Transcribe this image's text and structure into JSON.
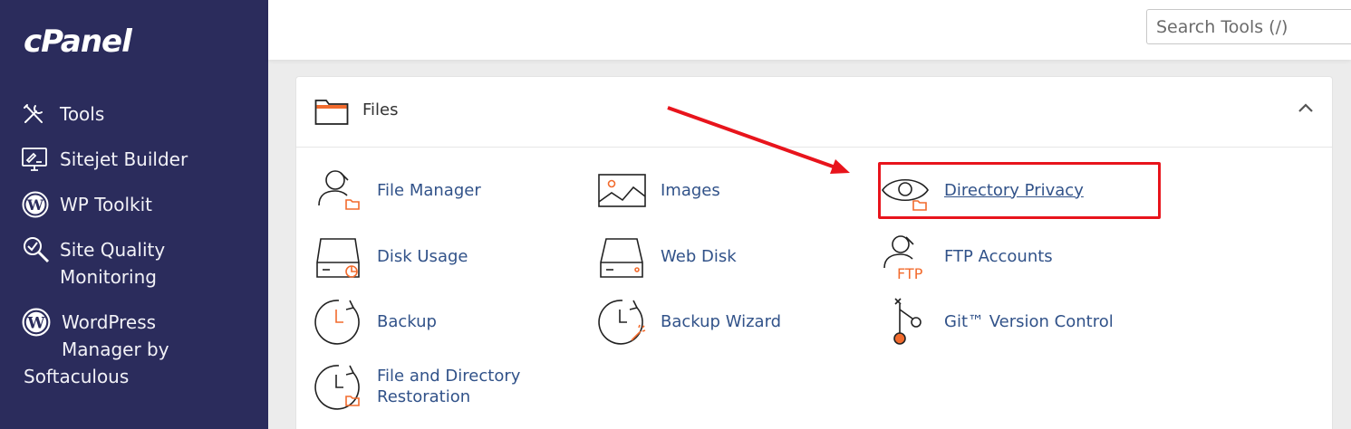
{
  "sidebar": {
    "logo": "cPanel",
    "items": [
      {
        "label": "Tools",
        "icon": "tools-icon"
      },
      {
        "label": "Sitejet Builder",
        "icon": "sitejet-icon"
      },
      {
        "label": "WP Toolkit",
        "icon": "wordpress-icon"
      },
      {
        "label": "Site Quality\nMonitoring",
        "icon": "site-quality-icon"
      },
      {
        "label": "WordPress\nManager by",
        "label_tail": "Softaculous",
        "icon": "wordpress-icon"
      }
    ]
  },
  "header": {
    "search_placeholder": "Search Tools (/)"
  },
  "panel": {
    "title": "Files",
    "tools": [
      {
        "label": "File Manager",
        "icon": "file-manager-icon"
      },
      {
        "label": "Images",
        "icon": "images-icon"
      },
      {
        "label": "Directory Privacy",
        "icon": "directory-privacy-icon"
      },
      {
        "label": "Disk Usage",
        "icon": "disk-usage-icon"
      },
      {
        "label": "Web Disk",
        "icon": "web-disk-icon"
      },
      {
        "label": "FTP Accounts",
        "icon": "ftp-accounts-icon"
      },
      {
        "label": "Backup",
        "icon": "backup-icon"
      },
      {
        "label": "Backup Wizard",
        "icon": "backup-wizard-icon"
      },
      {
        "label": "Git™ Version Control",
        "icon": "git-icon"
      },
      {
        "label": "File and Directory\nRestoration",
        "icon": "restoration-icon"
      }
    ]
  },
  "colors": {
    "sidebar_bg": "#2b2c5c",
    "link": "#315289",
    "accent_orange": "#f26b2d",
    "highlight_red": "#e8141c"
  }
}
